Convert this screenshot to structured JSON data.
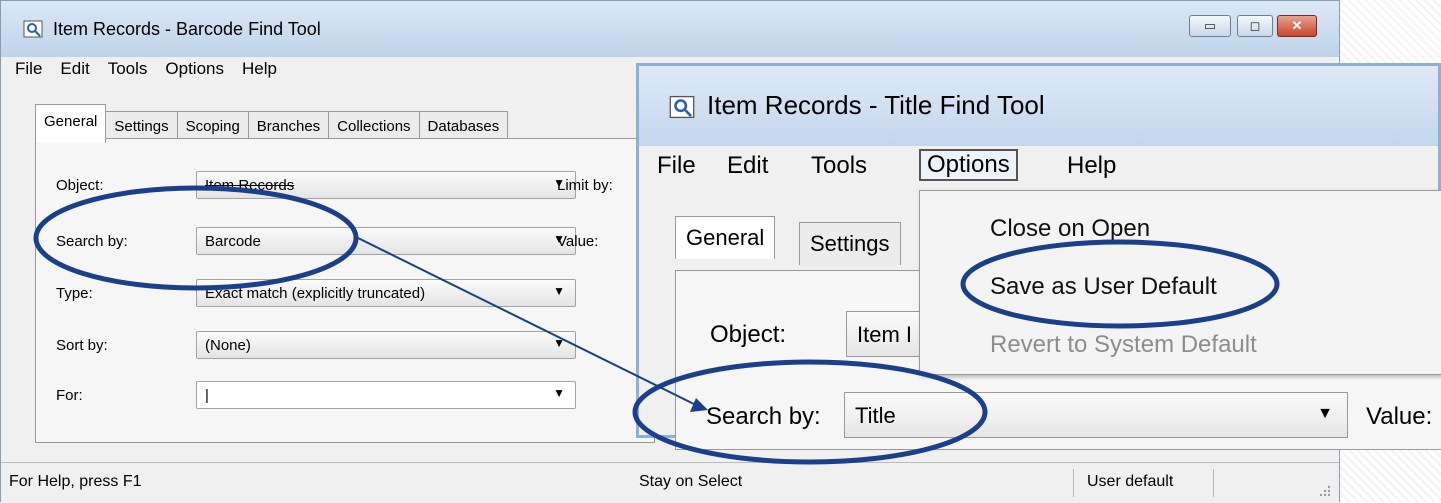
{
  "window1": {
    "title": "Item Records - Barcode Find Tool",
    "menu": [
      "File",
      "Edit",
      "Tools",
      "Options",
      "Help"
    ],
    "tabs": [
      "General",
      "Settings",
      "Scoping",
      "Branches",
      "Collections",
      "Databases"
    ],
    "fields": {
      "object_label": "Object:",
      "object_value": "Item Records",
      "search_label": "Search by:",
      "search_value": "Barcode",
      "type_label": "Type:",
      "type_value": "Exact match (explicitly truncated)",
      "sort_label": "Sort by:",
      "sort_value": "(None)",
      "for_label": "For:",
      "for_value": "|",
      "limit_label": "Limit by:",
      "value_label": "Value:"
    },
    "status": {
      "help": "For Help, press F1",
      "stay": "Stay on Select",
      "user_default": "User default"
    },
    "controls": {
      "minimize": "▭",
      "maximize": "◻",
      "close": "✕"
    }
  },
  "window2": {
    "title": "Item Records - Title Find Tool",
    "menu": [
      "File",
      "Edit",
      "Tools",
      "Options",
      "Help"
    ],
    "tabs": [
      "General",
      "Settings"
    ],
    "options_menu": {
      "items": [
        "Close on Open",
        "Save as User Default",
        "Revert to System Default"
      ],
      "disabled": [
        false,
        false,
        true
      ]
    },
    "fields": {
      "object_label": "Object:",
      "object_value": "Item I",
      "search_label": "Search by:",
      "search_value": "Title",
      "value_label": "Value:"
    }
  },
  "colors": {
    "annotation": "#1b3f8b",
    "titlebar": "#c3d6ec",
    "disabled_text": "#8d8d8d"
  },
  "icons": [
    "app-search-icon",
    "dropdown-arrow-icon",
    "resize-grip-icon"
  ]
}
